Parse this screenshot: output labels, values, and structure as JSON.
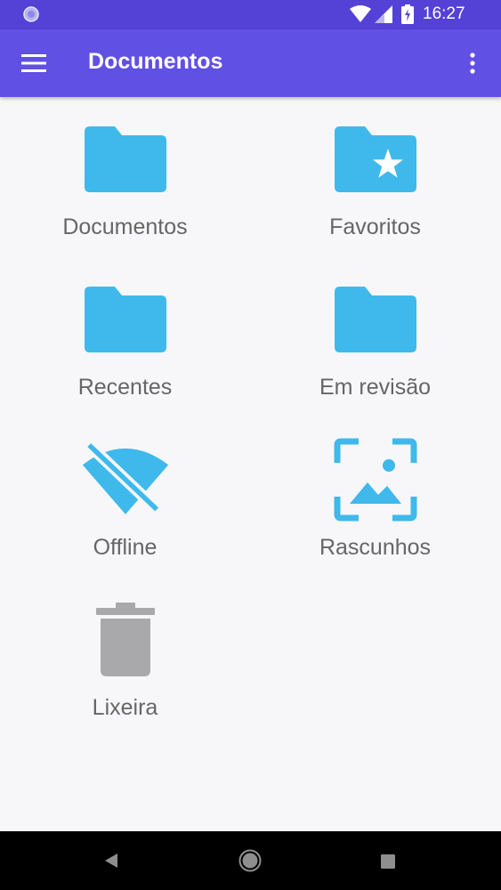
{
  "status_bar": {
    "time": "16:27",
    "icons": [
      "notification-icon",
      "wifi-icon",
      "signal-icon",
      "battery-charging-icon"
    ]
  },
  "app_bar": {
    "title": "Documentos",
    "icons": [
      "menu-icon",
      "overflow-menu-icon"
    ]
  },
  "items": [
    {
      "label": "Documentos",
      "icon": "folder-icon"
    },
    {
      "label": "Favoritos",
      "icon": "folder-star-icon"
    },
    {
      "label": "Recentes",
      "icon": "folder-icon"
    },
    {
      "label": "Em revisão",
      "icon": "folder-icon"
    },
    {
      "label": "Offline",
      "icon": "wifi-off-icon"
    },
    {
      "label": "Rascunhos",
      "icon": "image-frame-icon"
    },
    {
      "label": "Lixeira",
      "icon": "trash-icon"
    }
  ],
  "nav_bar": {
    "icons": [
      "back-icon",
      "home-icon",
      "recents-icon"
    ]
  },
  "colors": {
    "status_bar": "#5441d6",
    "app_bar": "#6150e4",
    "icon_blue": "#3fb9ec",
    "icon_gray": "#a9a9ab",
    "label_gray": "#666666",
    "background": "#f7f7f9"
  }
}
